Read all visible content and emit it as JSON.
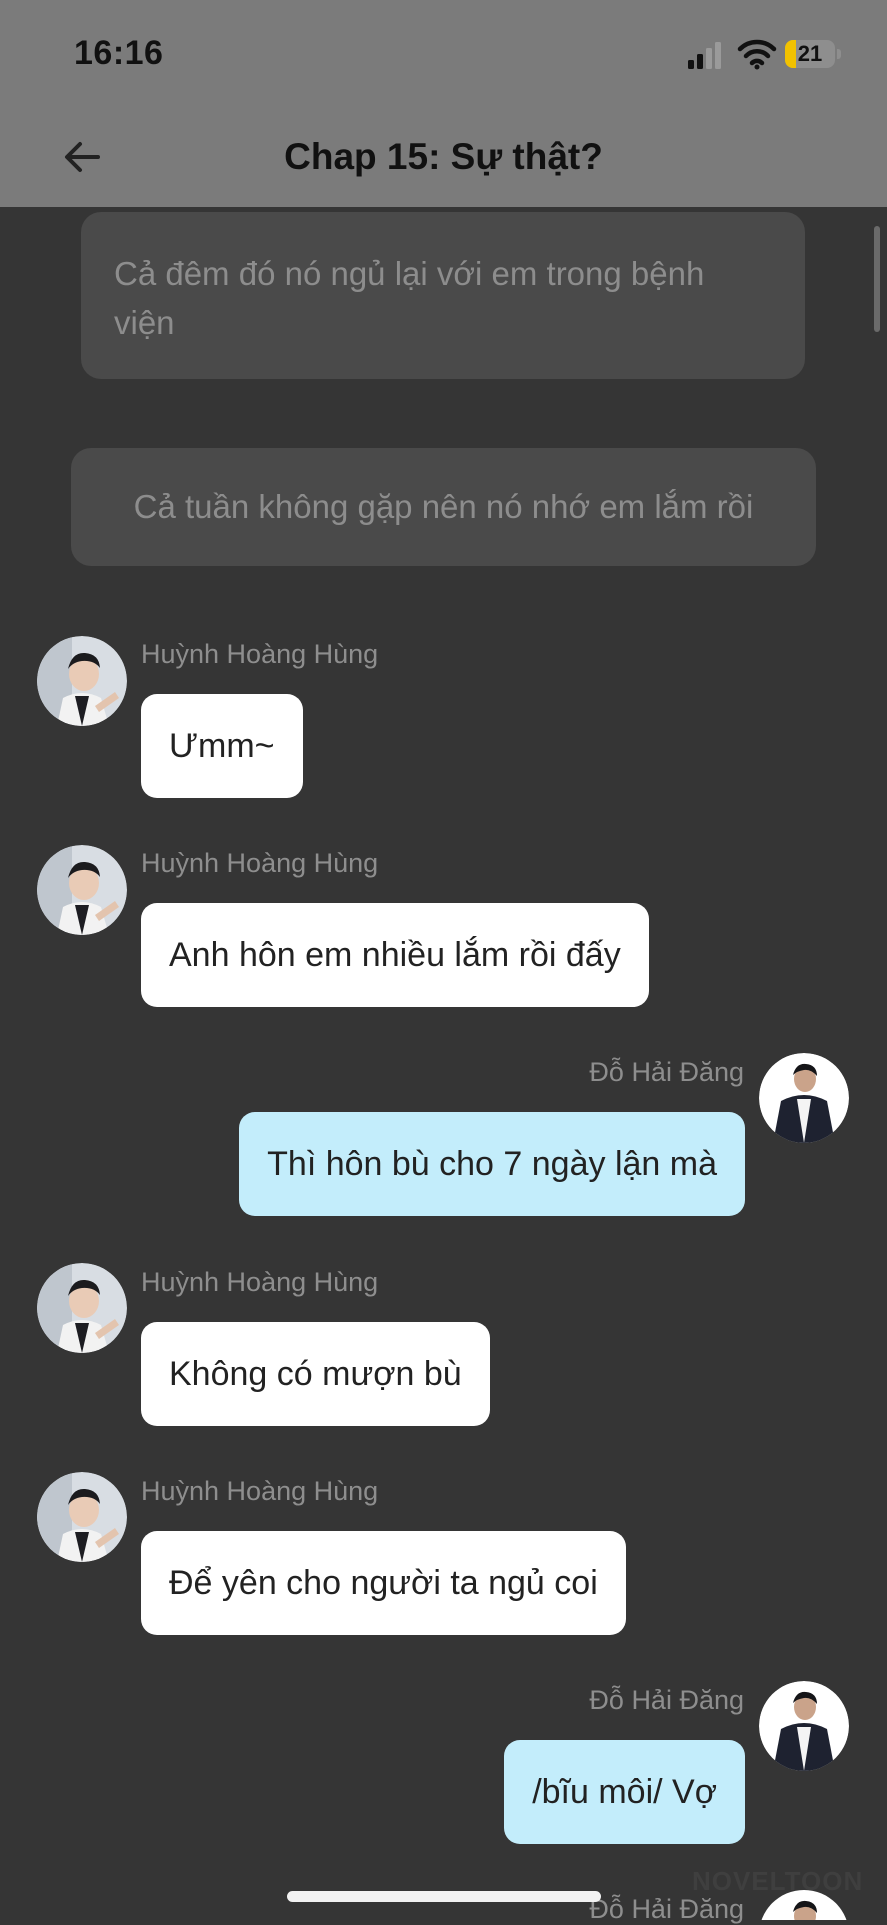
{
  "status_bar": {
    "time": "16:16",
    "battery_level": "21",
    "battery_fraction": 0.21
  },
  "header": {
    "title": "Chap 15: Sự thật?"
  },
  "narrations": [
    "Cả đêm đó nó ngủ lại với em trong bệnh viện",
    "Cả tuần không gặp nên nó nhớ em lắm rồi"
  ],
  "messages": [
    {
      "sender": "Huỳnh Hoàng Hùng",
      "text": "Ưmm~",
      "side": "left"
    },
    {
      "sender": "Huỳnh Hoàng Hùng",
      "text": "Anh hôn em nhiều lắm rồi đấy",
      "side": "left"
    },
    {
      "sender": "Đỗ Hải Đăng",
      "text": "Thì hôn bù cho 7 ngày lận mà",
      "side": "right"
    },
    {
      "sender": "Huỳnh Hoàng Hùng",
      "text": "Không có mượn bù",
      "side": "left"
    },
    {
      "sender": "Huỳnh Hoàng Hùng",
      "text": "Để yên cho người ta ngủ coi",
      "side": "left"
    },
    {
      "sender": "Đỗ Hải Đăng",
      "text": "/bĩu môi/ Vợ",
      "side": "right"
    },
    {
      "sender": "Đỗ Hải Đăng",
      "text": "",
      "side": "right"
    }
  ],
  "watermark": "NOVELTOON",
  "colors": {
    "background": "#353535",
    "header": "#7b7b7b",
    "narration_bg": "#4a4a4a",
    "bubble_left": "#ffffff",
    "bubble_right": "#c3edfb",
    "battery_fill": "#f2c200"
  }
}
